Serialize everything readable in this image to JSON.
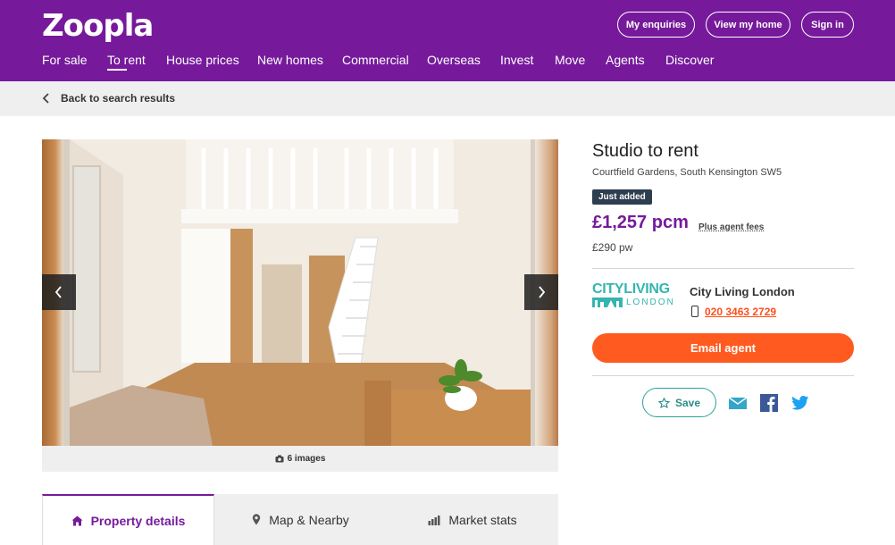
{
  "header": {
    "logo": "Zoopla",
    "buttons": [
      "My enquiries",
      "View my home",
      "Sign in"
    ],
    "nav": [
      "For sale",
      "To rent",
      "House prices",
      "New homes",
      "Commercial",
      "Overseas",
      "Invest",
      "Move",
      "Agents",
      "Discover"
    ],
    "active_nav": "To rent"
  },
  "breadcrumb": {
    "back_label": "Back to search results"
  },
  "gallery": {
    "image_count_label": "6 images"
  },
  "tabs": [
    "Property details",
    "Map & Nearby",
    "Market stats"
  ],
  "listing": {
    "title": "Studio to rent",
    "address": "Courtfield Gardens, South Kensington SW5",
    "badge": "Just added",
    "price": "£1,257 pcm",
    "fees_link": "Plus agent fees",
    "price_weekly": "£290 pw"
  },
  "agent": {
    "logo_line1": "CITYLIVING",
    "logo_line2": "LONDON",
    "name": "City Living London",
    "phone": "020 3463 2729",
    "email_label": "Email agent"
  },
  "actions": {
    "save_label": "Save"
  },
  "colors": {
    "brand": "#761a9b",
    "accent": "#ff5a1f",
    "teal": "#2aa39b",
    "badge": "#2d3e50"
  }
}
